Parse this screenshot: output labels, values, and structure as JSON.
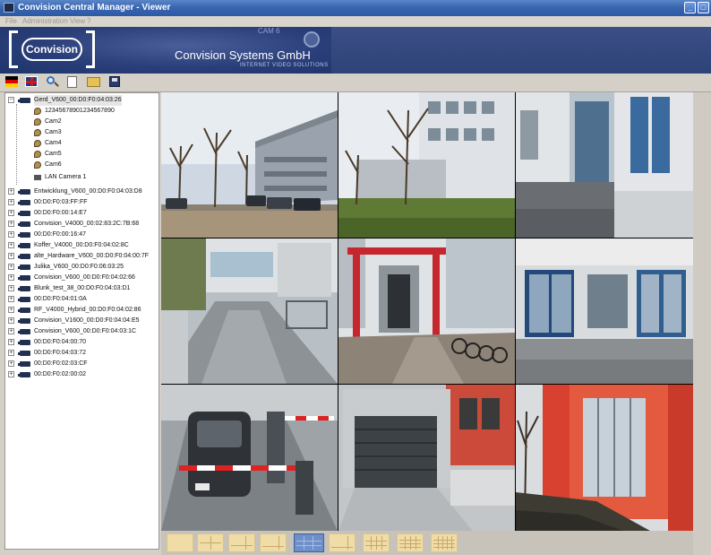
{
  "window": {
    "title": "Convision Central Manager - Viewer",
    "minimize_glyph": "_",
    "maximize_glyph": "□"
  },
  "menu": {
    "items": [
      "File",
      "Administration",
      "View",
      "?"
    ]
  },
  "banner": {
    "logo_text": "Convision",
    "company_name": "Convision Systems GmbH",
    "tagline": "INTERNET VIDEO SOLUTIONS",
    "decor_text": "CAM 6"
  },
  "toolbar": {
    "icons": [
      "german-flag-icon",
      "uk-flag-icon",
      "search-icon",
      "new-document-icon",
      "open-folder-icon",
      "save-icon"
    ]
  },
  "tree": {
    "root": {
      "label": "Gerd_V600_00:D0:F0:04:03:26",
      "expander": "−",
      "children": [
        "12345678901234567890",
        "Cam2",
        "Cam3",
        "Cam4",
        "Cam5",
        "Cam6",
        "LAN Camera 1"
      ]
    },
    "devices": [
      "Entwicklung_V600_00:D0:F0:04:03:D8",
      "00:D0:F0:03:FF:FF",
      "00:D0:F0:00:14:E7",
      "Convision_V4000_00:02:83:2C:7B:68",
      "00:D0:F0:00:16:47",
      "Koffer_V4000_00:D0:F0:04:02:8C",
      "alte_Hardware_V600_00:D0:F0:04:00:7F",
      "Julika_V600_00:D0:F0:06:03:25",
      "Convision_V600_00:D0:F0:04:02:66",
      "Blunk_test_38_00:D0:F0:04:03:D1",
      "00:D0:F0:04:01:0A",
      "RF_V4000_Hybrid_00:D0:F0:04:02:86",
      "Convision_V1600_00:D0:F0:04:04:E5",
      "Convision_V600_00:D0:F0:04:03:1C",
      "00:D0:F0:04:00:70",
      "00:D0:F0:04:03:72",
      "00:D0:F0:02:03:CF",
      "00:D0:F0:02:00:02"
    ],
    "collapsed_glyph": "+"
  },
  "video_grid": {
    "cells": [
      {
        "name": "video-cell-parking-lot-building"
      },
      {
        "name": "video-cell-courtyard-trees"
      },
      {
        "name": "video-cell-building-entrance-glass"
      },
      {
        "name": "video-cell-garage-ramp"
      },
      {
        "name": "video-cell-red-frame-bicycles"
      },
      {
        "name": "video-cell-glass-entrance-doors"
      },
      {
        "name": "video-cell-car-barrier-gate"
      },
      {
        "name": "video-cell-garage-door"
      },
      {
        "name": "video-cell-red-facade-windows"
      }
    ]
  },
  "layout_bar": {
    "active_index": 4,
    "buttons": [
      "layout-1x1",
      "layout-2x2",
      "layout-1-plus-3",
      "layout-1-plus-5",
      "layout-3x3",
      "layout-1-plus-7",
      "layout-4x4",
      "layout-4x4-alt",
      "layout-5x5"
    ]
  }
}
